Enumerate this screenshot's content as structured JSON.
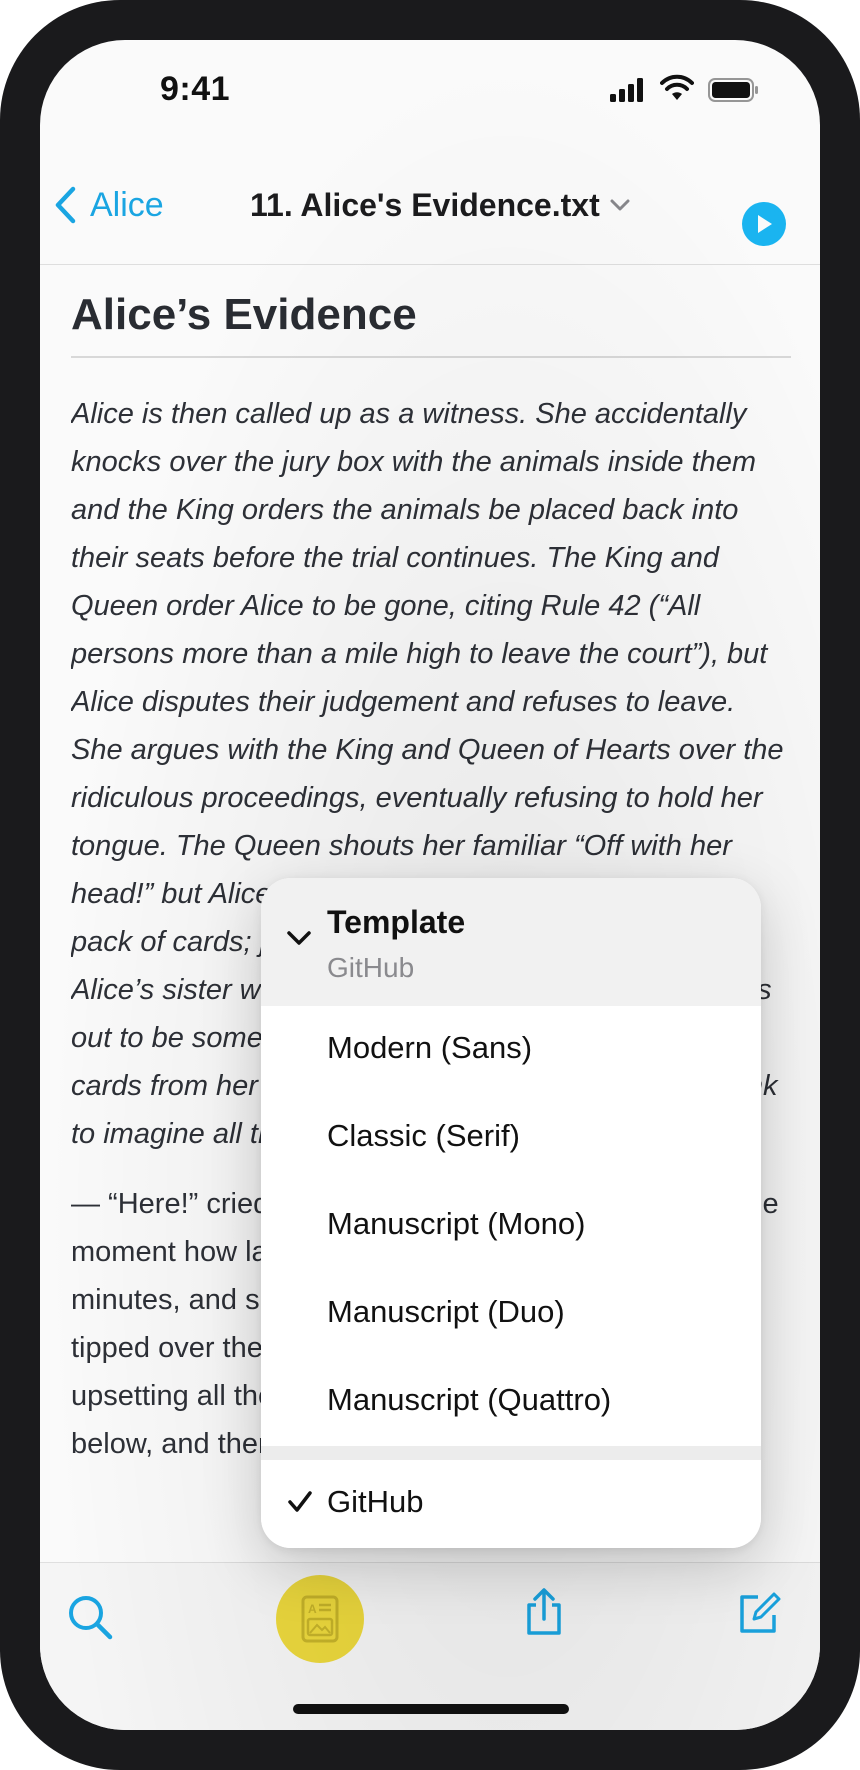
{
  "status_bar": {
    "time": "9:41"
  },
  "nav": {
    "back_label": "Alice",
    "title": "11. Alice's Evidence.txt"
  },
  "document": {
    "heading": "Alice’s Evidence",
    "paragraph1": "Alice is then called up as a witness. She accidentally knocks over the jury box with the animals inside them and the King orders the animals be placed back into their seats before the trial continues. The King and Queen order Alice to be gone, citing Rule 42 (“All persons more than a mile high to leave the court”), but Alice disputes their judgement and refuses to leave. She argues with the King and Queen of Hearts over the ridiculous proceedings, eventually refusing to hold her tongue. The Queen shouts her familiar “Off with her head!” but Alice is unafraid, calling them out as just a pack of cards; just as they start to swarm over her. Alice’s sister wakes her up for tea, brushing what turns out to be some leaves and not a shower of playing cards from her face. Alice leaves her sister on the bank to imagine all the curious happenings for herself.",
    "paragraph2": "— “Here!” cried Alice, quite forgetting in the flurry of the moment how large she had grown in the last few minutes, and she jumped up in such a hurry that she tipped over the jury-box with the edge of her skirt, upsetting all the jurymen on to the heads of the crowd below, and there they lay"
  },
  "menu": {
    "header_title": "Template",
    "header_subtitle": "GitHub",
    "items": [
      {
        "label": "Modern (Sans)"
      },
      {
        "label": "Classic (Serif)"
      },
      {
        "label": "Manuscript (Mono)"
      },
      {
        "label": "Manuscript (Duo)"
      },
      {
        "label": "Manuscript (Quattro)"
      }
    ],
    "selected_item": {
      "label": "GitHub"
    }
  },
  "toolbar": {
    "icons": [
      "search-icon",
      "template-icon",
      "share-icon",
      "compose-icon"
    ]
  },
  "colors": {
    "accent": "#1aa8e6",
    "template_button": "#f0dc3e"
  }
}
